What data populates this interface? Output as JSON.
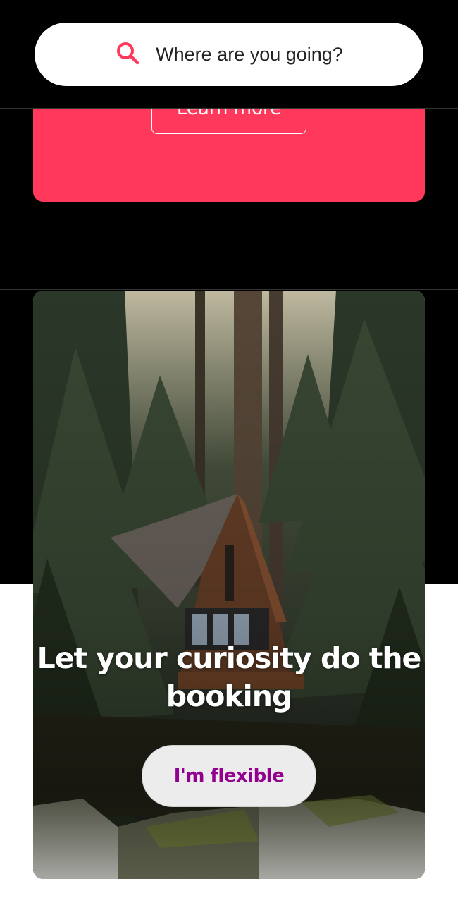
{
  "search": {
    "placeholder": "Where are you going?",
    "icon": "search-icon"
  },
  "promo": {
    "button_label": "Learn more"
  },
  "hero": {
    "title": "Let your curiosity do the booking",
    "button_label": "I'm flexible"
  },
  "colors": {
    "brand": "#ff385c",
    "flexible_text": "#92008f"
  }
}
